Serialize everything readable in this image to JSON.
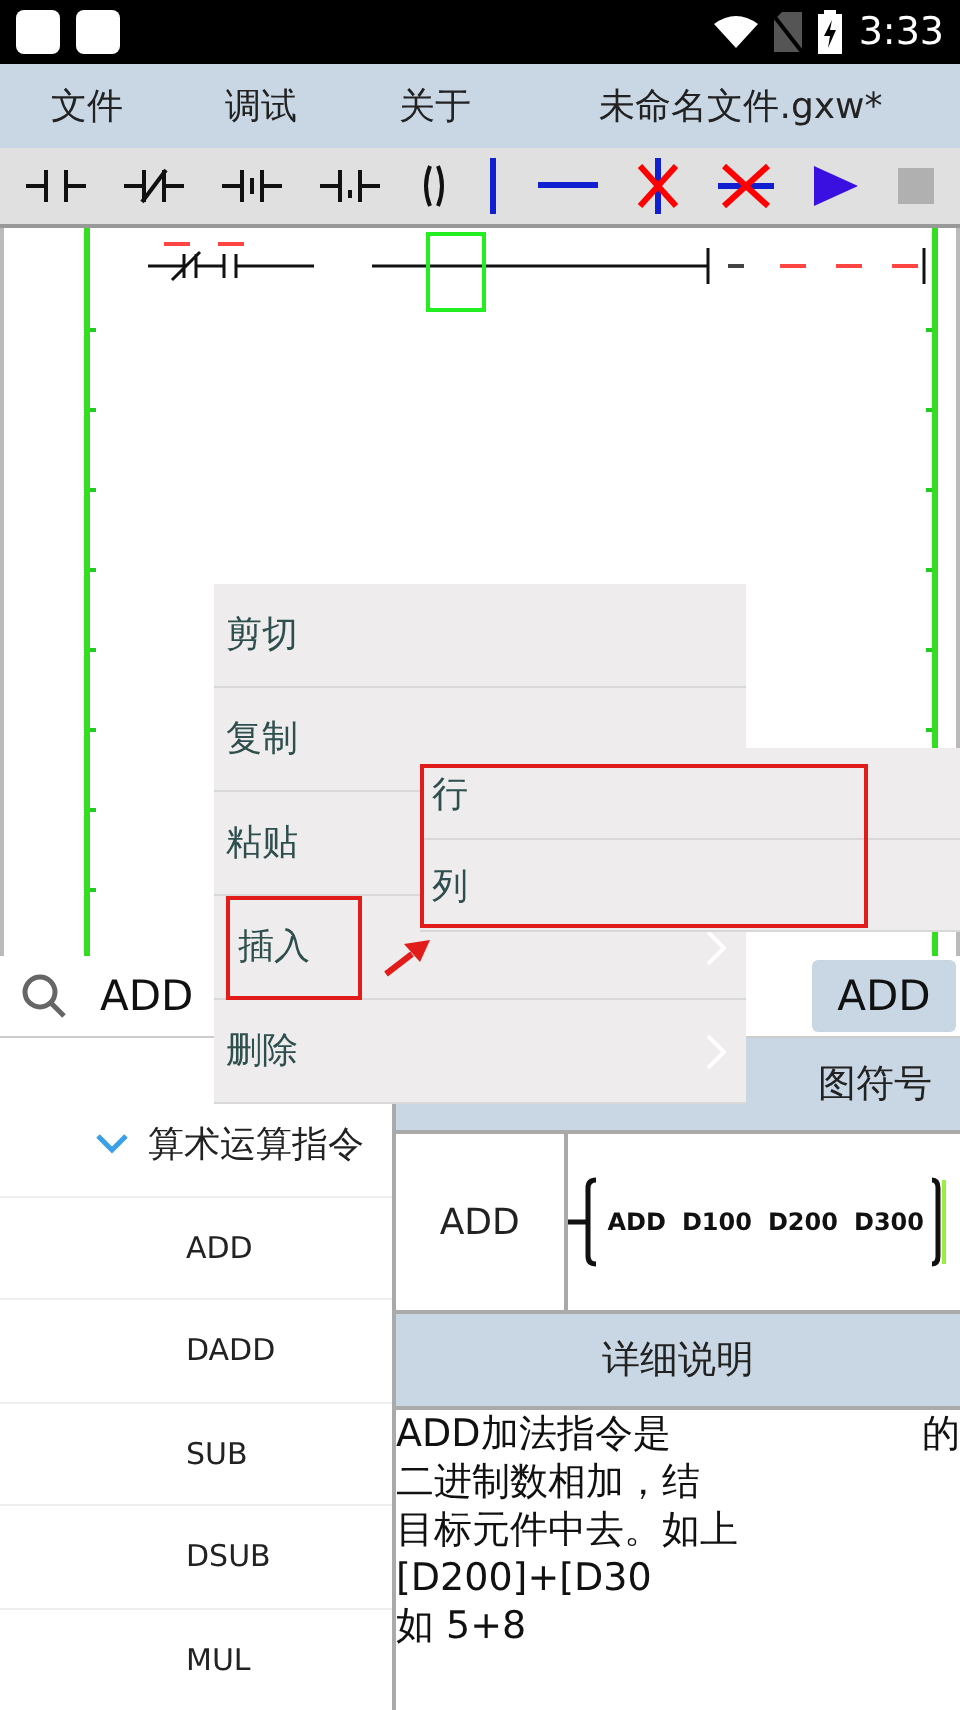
{
  "status_bar": {
    "time": "3:33"
  },
  "menu": [
    "文件",
    "调试",
    "关于"
  ],
  "file_title": "未命名文件.gxw*",
  "search": {
    "value": "ADD"
  },
  "search_button": "ADD",
  "tree": {
    "group": {
      "label": "算术运算指令",
      "expanded": true
    },
    "items": [
      "ADD",
      "DADD",
      "SUB",
      "DSUB",
      "MUL"
    ]
  },
  "symbol_header": "图符号",
  "symbol_row": {
    "name": "ADD",
    "operands": [
      "ADD",
      "D100",
      "D200",
      "D300"
    ]
  },
  "detail_header": "详细说明",
  "description": [
    {
      "left": "ADD加法指令是",
      "right": "的"
    },
    {
      "left": "二进制数相加，结"
    },
    {
      "left": "目标元件中去。如上"
    },
    {
      "left": "[D200]+[D30"
    },
    {
      "left": "如 5+8"
    }
  ],
  "context_menu": {
    "items": [
      {
        "label": "剪切",
        "has_submenu": false,
        "highlighted": false
      },
      {
        "label": "复制",
        "has_submenu": false,
        "highlighted": false
      },
      {
        "label": "粘贴",
        "has_submenu": false,
        "highlighted": false
      },
      {
        "label": "插入",
        "has_submenu": true,
        "highlighted": true
      },
      {
        "label": "删除",
        "has_submenu": true,
        "highlighted": false
      }
    ]
  },
  "submenu": {
    "items": [
      "行",
      "列"
    ],
    "highlighted": true
  }
}
